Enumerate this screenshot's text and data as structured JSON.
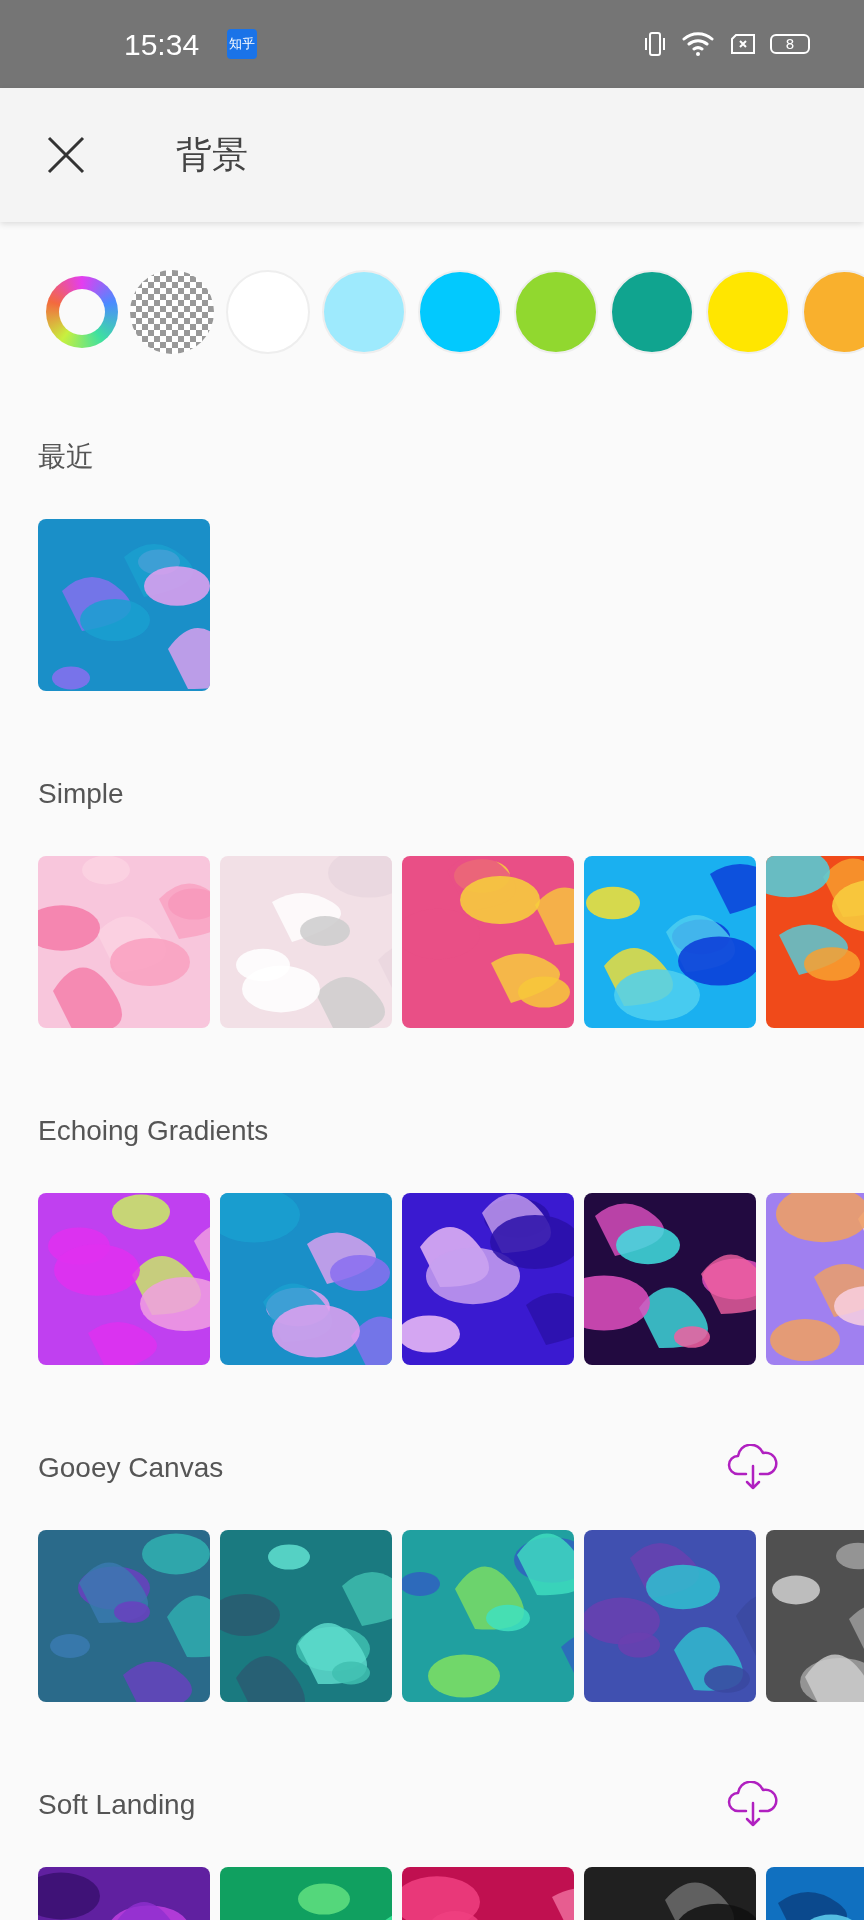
{
  "status_bar": {
    "time": "15:34",
    "app_badge": "知乎",
    "battery": "8"
  },
  "header": {
    "title": "背景"
  },
  "swatches": [
    {
      "kind": "wheel"
    },
    {
      "kind": "transparent"
    },
    {
      "kind": "solid",
      "color": "#ffffff"
    },
    {
      "kind": "solid",
      "color": "#9eeafd"
    },
    {
      "kind": "solid",
      "color": "#02c9fe"
    },
    {
      "kind": "solid",
      "color": "#91d82f"
    },
    {
      "kind": "solid",
      "color": "#10a48f"
    },
    {
      "kind": "solid",
      "color": "#ffe600"
    },
    {
      "kind": "solid",
      "color": "#f9b02d"
    }
  ],
  "sections": [
    {
      "title": "最近",
      "downloadable": false
    },
    {
      "title": "Simple",
      "downloadable": false
    },
    {
      "title": "Echoing Gradients",
      "downloadable": false
    },
    {
      "title": "Gooey Canvas",
      "downloadable": true
    },
    {
      "title": "Soft Landing",
      "downloadable": true
    }
  ]
}
